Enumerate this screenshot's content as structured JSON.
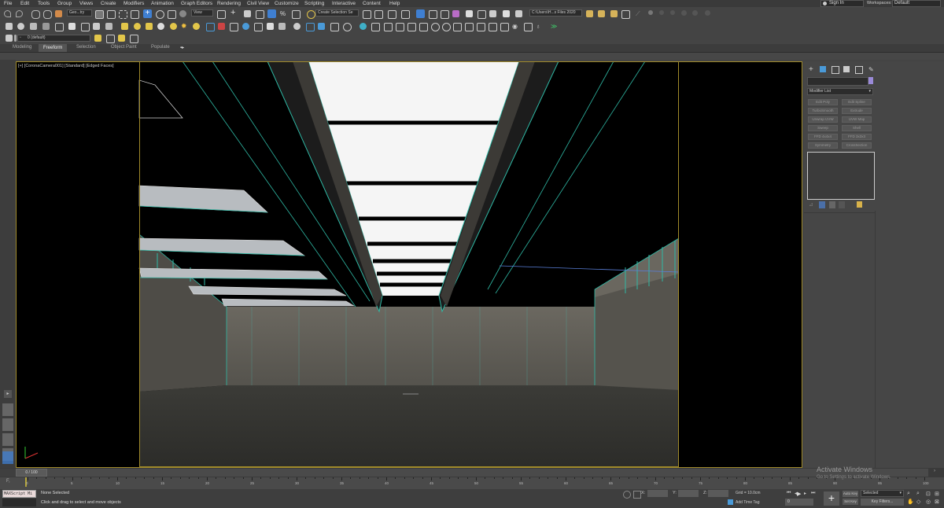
{
  "menu": [
    "File",
    "Edit",
    "Tools",
    "Group",
    "Views",
    "Create",
    "Modifiers",
    "Animation",
    "Graph Editors",
    "Rendering",
    "Civil View",
    "Customize",
    "Scripting",
    "Interactive",
    "Content",
    "Help"
  ],
  "account": {
    "sign_in": "Sign In",
    "workspaces_label": "Workspaces:",
    "workspace_value": "Default"
  },
  "toolbar": {
    "selection_filter": "Geo...try",
    "ref_coord": "View",
    "named_selection": "Create Selection Se",
    "project_path": "C:\\Users\\H...s Files 2020",
    "layer": "0 (default)"
  },
  "ribbon_tabs": [
    "Modeling",
    "Freeform",
    "Selection",
    "Object Paint",
    "Populate"
  ],
  "viewport": {
    "label": "[+] [CoronaCamera001] [Standard] [Edged Faces]"
  },
  "command_panel": {
    "modifier_list": "Modifier List",
    "buttons": [
      "Edit Poly",
      "Edit Spline",
      "TurboSmooth",
      "Extrude",
      "Unwrap UVW",
      "UVW Map",
      "Sweep",
      "Shell",
      "FFD 4x4x4",
      "FFD 3x3x3",
      "Symmetry",
      "CrossSection"
    ]
  },
  "timeline": {
    "frame_readout": "0 / 100",
    "ticks": [
      "0",
      "5",
      "10",
      "15",
      "20",
      "25",
      "30",
      "35",
      "40",
      "45",
      "50",
      "55",
      "60",
      "65",
      "70",
      "75",
      "80",
      "85",
      "90",
      "95",
      "100"
    ]
  },
  "status": {
    "maxscript": "MAXScript Mi",
    "none_selected": "None Selected",
    "prompt": "Click and drag to select and move objects",
    "x_label": "X:",
    "y_label": "Y:",
    "z_label": "Z:",
    "grid": "Grid = 10.0cm",
    "add_time_tag": "Add Time Tag",
    "auto_key": "Auto Key",
    "set_key": "Set Key",
    "selected": "Selected",
    "key_filters": "Key Filters...",
    "frame": "0"
  },
  "watermark": {
    "title": "Activate Windows",
    "subtitle": "Go to Settings to activate Windows."
  },
  "colors": {
    "wire": "#2fb9a5",
    "viewport_border": "#a08a2a",
    "accent": "#3f7fd1"
  }
}
